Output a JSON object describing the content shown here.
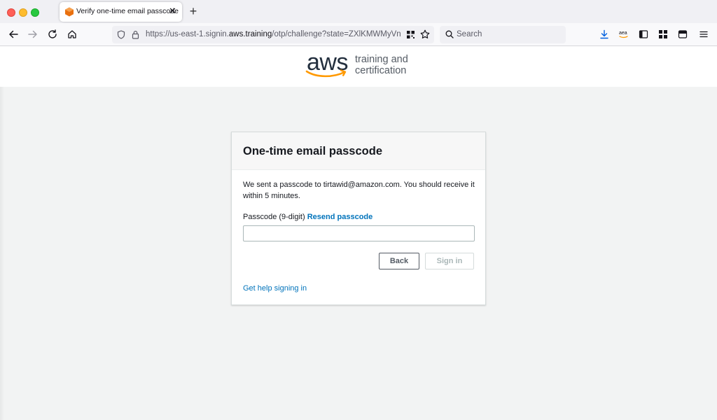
{
  "browser": {
    "tab": {
      "title": "Verify one-time email passcode",
      "close": "✕"
    },
    "newtab": "+",
    "url": {
      "prefix": "https://us-east-1.signin.",
      "domain": "aws.training",
      "path": "/otp/challenge?state=ZXlKMWMyVn"
    },
    "search_placeholder": "Search"
  },
  "brand": {
    "logo_text": "aws",
    "tagline_line1": "training and",
    "tagline_line2": "certification",
    "colors": {
      "smile": "#ff9900",
      "ink": "#232f3e",
      "link": "#0073bb"
    }
  },
  "card": {
    "title": "One-time email passcode",
    "message": "We sent a passcode to tirtawid@amazon.com. You should receive it within 5 minutes.",
    "field_label": "Passcode (9-digit)",
    "resend_link": "Resend passcode",
    "input_value": "",
    "back_label": "Back",
    "signin_label": "Sign in",
    "help_link": "Get help signing in"
  }
}
